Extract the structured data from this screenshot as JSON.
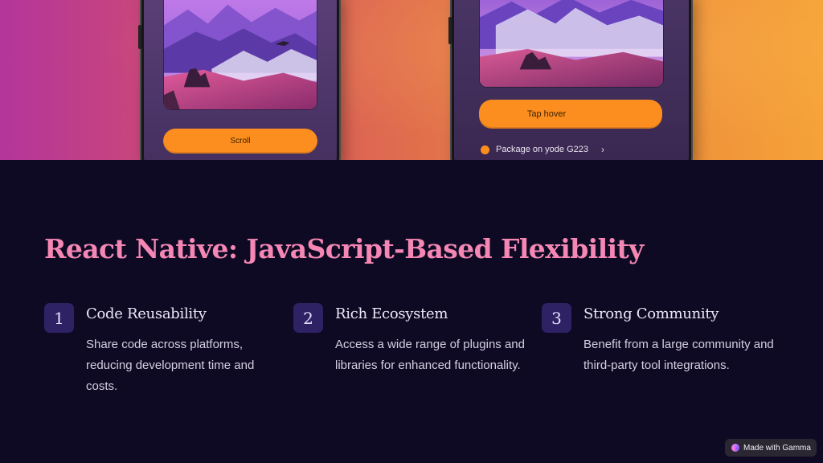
{
  "hero": {
    "left_phone": {
      "button_label": "Scroll"
    },
    "right_phone": {
      "button_label": "Tap hover",
      "package_text": "Package on yode G223",
      "chevron_icon": "chevron-right-icon"
    }
  },
  "title": "React Native: JavaScript-Based Flexibility",
  "features": [
    {
      "number": "1",
      "title": "Code Reusability",
      "description": "Share code across platforms, reducing development time and costs."
    },
    {
      "number": "2",
      "title": "Rich Ecosystem",
      "description": "Access a wide range of plugins and libraries for enhanced functionality."
    },
    {
      "number": "3",
      "title": "Strong Community",
      "description": "Benefit from a large community and third-party tool integrations."
    }
  ],
  "badge": {
    "label": "Made with Gamma",
    "icon": "gamma-logo-icon"
  },
  "colors": {
    "background": "#0f0a24",
    "title": "#f487b4",
    "number_badge": "#2e2264",
    "phone_button": "#fb8e1e"
  }
}
